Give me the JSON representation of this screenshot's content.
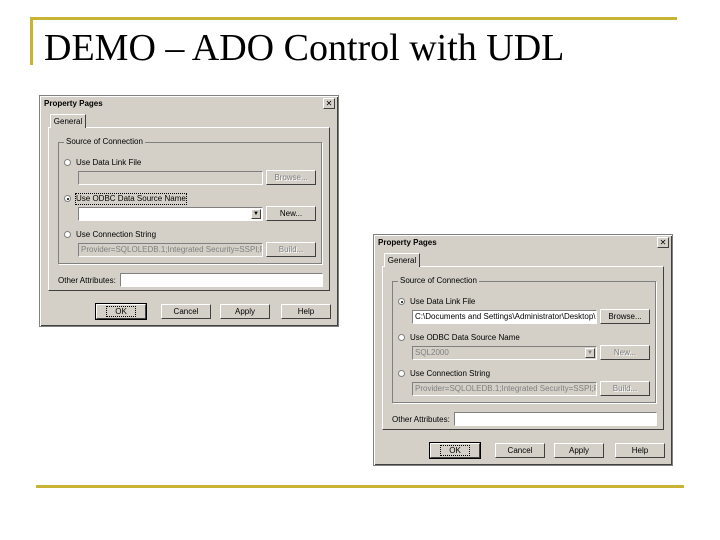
{
  "slide": {
    "title": "DEMO – ADO Control with UDL"
  },
  "dialog1": {
    "title": "Property Pages",
    "tab": "General",
    "group_title": "Source of Connection",
    "options": [
      {
        "label": "Use Data Link File",
        "checked": false,
        "value": "",
        "button": "Browse..."
      },
      {
        "label": "Use ODBC Data Source Name",
        "checked": true,
        "value": "",
        "button": "New..."
      },
      {
        "label": "Use Connection String",
        "checked": false,
        "value": "Provider=SQLOLEDB.1;Integrated Security=SSPI;P",
        "button": "Build..."
      }
    ],
    "other_attributes_label": "Other Attributes:",
    "other_attributes_value": "",
    "footer": {
      "ok": "OK",
      "cancel": "Cancel",
      "apply": "Apply",
      "help": "Help"
    }
  },
  "dialog2": {
    "title": "Property Pages",
    "tab": "General",
    "group_title": "Source of Connection",
    "options": [
      {
        "label": "Use Data Link File",
        "checked": true,
        "value": "C:\\Documents and Settings\\Administrator\\Desktop\\",
        "button": "Browse..."
      },
      {
        "label": "Use ODBC Data Source Name",
        "checked": false,
        "value": "SQL2000",
        "button": "New..."
      },
      {
        "label": "Use Connection String",
        "checked": false,
        "value": "Provider=SQLOLEDB.1;Integrated Security=SSPI;P",
        "button": "Build..."
      }
    ],
    "other_attributes_label": "Other Attributes:",
    "other_attributes_value": "",
    "footer": {
      "ok": "OK",
      "cancel": "Cancel",
      "apply": "Apply",
      "help": "Help"
    }
  }
}
